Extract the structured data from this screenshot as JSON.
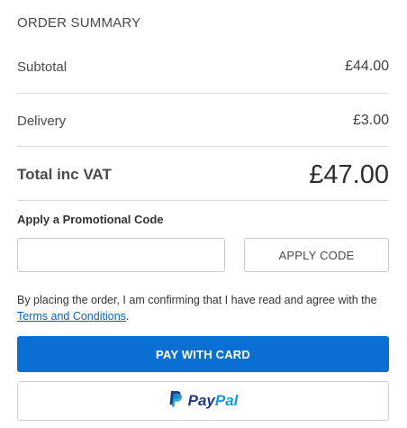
{
  "summary": {
    "title": "ORDER SUMMARY",
    "subtotal_label": "Subtotal",
    "subtotal_value": "£44.00",
    "delivery_label": "Delivery",
    "delivery_value": "£3.00",
    "total_label": "Total inc VAT",
    "total_value": "£47.00"
  },
  "promo": {
    "label": "Apply a Promotional Code",
    "input_value": "",
    "input_placeholder": "",
    "apply_label": "APPLY CODE"
  },
  "agreement": {
    "text_before": "By placing the order, I am confirming that I have read and agree with the ",
    "link_text": "Terms and Conditions",
    "text_after": "."
  },
  "payment": {
    "card_label": "PAY WITH CARD",
    "paypal_part1": "Pay",
    "paypal_part2": "Pal"
  },
  "colors": {
    "accent": "#0a6fd3",
    "link": "#0b63b4",
    "paypal_dark": "#253b80",
    "paypal_light": "#179bd7"
  }
}
